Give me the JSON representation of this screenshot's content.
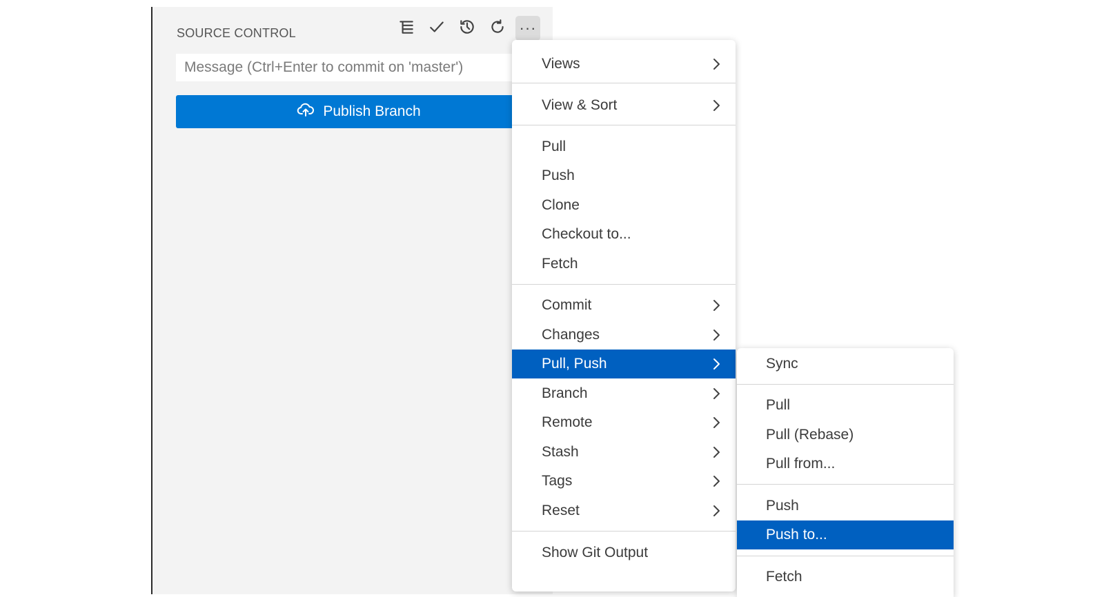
{
  "panel": {
    "title": "SOURCE CONTROL",
    "toolbar": {
      "icons": [
        "list-tree-icon",
        "check-icon",
        "history-icon",
        "refresh-icon",
        "more-icon"
      ],
      "more_label": "···"
    },
    "message_placeholder": "Message (Ctrl+Enter to commit on 'master')",
    "publish_label": "Publish Branch"
  },
  "main_menu": {
    "items": [
      {
        "label": "Views",
        "submenu": true
      },
      {
        "label": "View & Sort",
        "submenu": true
      },
      {
        "label": "Pull",
        "submenu": false
      },
      {
        "label": "Push",
        "submenu": false
      },
      {
        "label": "Clone",
        "submenu": false
      },
      {
        "label": "Checkout to...",
        "submenu": false
      },
      {
        "label": "Fetch",
        "submenu": false
      },
      {
        "label": "Commit",
        "submenu": true
      },
      {
        "label": "Changes",
        "submenu": true
      },
      {
        "label": "Pull, Push",
        "submenu": true,
        "highlighted": true
      },
      {
        "label": "Branch",
        "submenu": true
      },
      {
        "label": "Remote",
        "submenu": true
      },
      {
        "label": "Stash",
        "submenu": true
      },
      {
        "label": "Tags",
        "submenu": true
      },
      {
        "label": "Reset",
        "submenu": true
      },
      {
        "label": "Show Git Output",
        "submenu": false
      }
    ]
  },
  "sub_menu": {
    "items": [
      {
        "label": "Sync"
      },
      {
        "label": "Pull"
      },
      {
        "label": "Pull (Rebase)"
      },
      {
        "label": "Pull from..."
      },
      {
        "label": "Push"
      },
      {
        "label": "Push to...",
        "highlighted": true
      },
      {
        "label": "Fetch"
      }
    ]
  },
  "colors": {
    "accent": "#0078d4",
    "menu_highlight": "#0060c0",
    "panel_bg": "#f3f3f3"
  }
}
